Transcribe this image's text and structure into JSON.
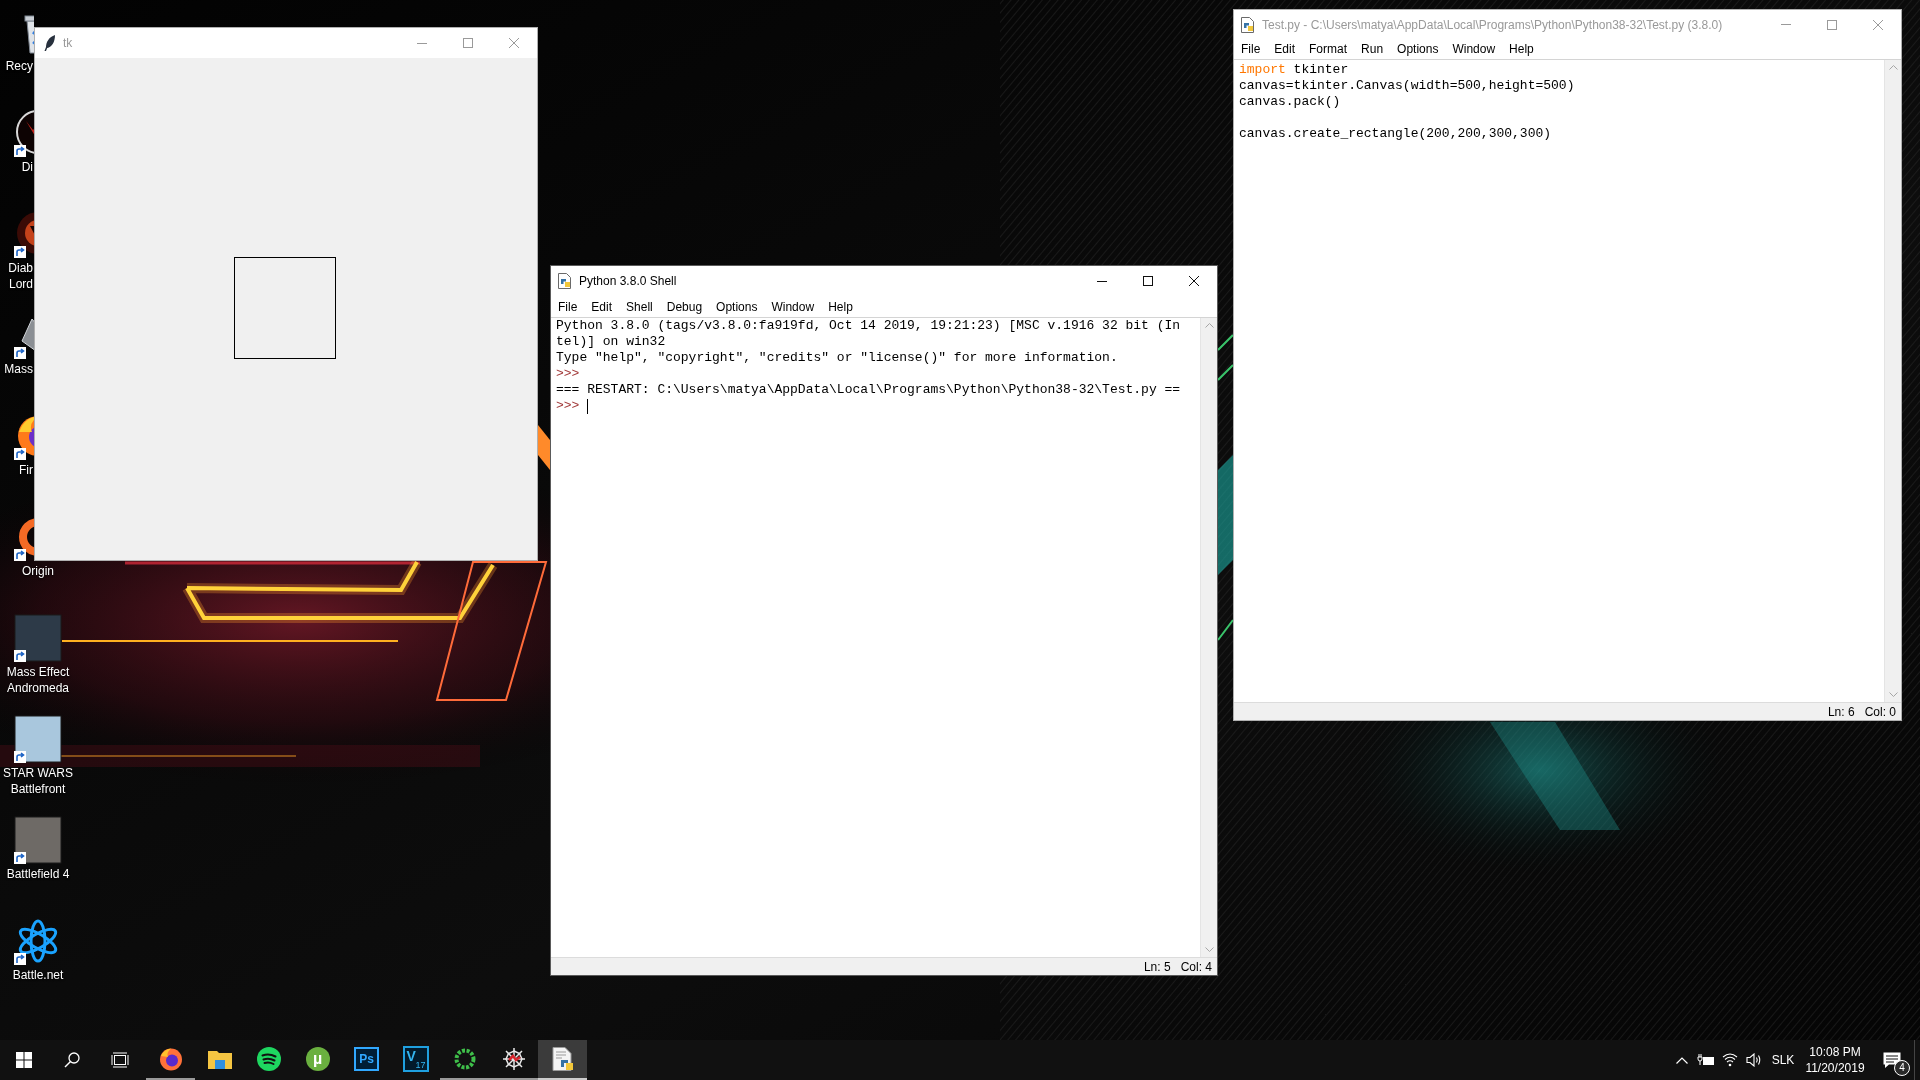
{
  "desktop_icons": [
    {
      "label": "Recy",
      "kind": "bin",
      "shortcut": false
    },
    {
      "label": "Di",
      "kind": "demon",
      "shortcut": true
    },
    {
      "label": "Diab Lord",
      "kind": "fiend",
      "shortcut": true
    },
    {
      "label": "Mass",
      "kind": "shard",
      "shortcut": true
    },
    {
      "label": "Fir",
      "kind": "browser",
      "shortcut": true
    },
    {
      "label": "Origin",
      "kind": "ring",
      "shortcut": true
    },
    {
      "label": "Mass Effect Andromeda",
      "kind": "cover",
      "color": "#2d3a48",
      "shortcut": true
    },
    {
      "label": "STAR WARS Battlefront",
      "kind": "cover",
      "color": "#a9c7dd",
      "shortcut": true
    },
    {
      "label": "Battlefield 4",
      "kind": "cover",
      "color": "#6e6a66",
      "shortcut": true
    },
    {
      "label": "Battle.net",
      "kind": "swirl",
      "shortcut": true
    }
  ],
  "tk_window": {
    "title": "tk",
    "active": false
  },
  "shell_window": {
    "title": "Python 3.8.0 Shell",
    "active": true,
    "menu": [
      "File",
      "Edit",
      "Shell",
      "Debug",
      "Options",
      "Window",
      "Help"
    ],
    "lines": [
      {
        "kind": "output",
        "text": "Python 3.8.0 (tags/v3.8.0:fa919fd, Oct 14 2019, 19:21:23) [MSC v.1916 32 bit (In",
        "cursor": false
      },
      {
        "kind": "output",
        "text": "tel)] on win32",
        "cursor": false
      },
      {
        "kind": "output",
        "text": "Type \"help\", \"copyright\", \"credits\" or \"license()\" for more information.",
        "cursor": false
      },
      {
        "kind": "prompt",
        "text": ">>>",
        "cursor": false
      },
      {
        "kind": "output",
        "text": "=== RESTART: C:\\Users\\matya\\AppData\\Local\\Programs\\Python\\Python38-32\\Test.py ==",
        "cursor": false
      },
      {
        "kind": "prompt",
        "text": ">>>",
        "cursor": true
      }
    ],
    "status": [
      "Ln: 5",
      "Col: 4"
    ]
  },
  "editor_window": {
    "title": "Test.py - C:\\Users\\matya\\AppData\\Local\\Programs\\Python\\Python38-32\\Test.py (3.8.0)",
    "active": false,
    "menu": [
      "File",
      "Edit",
      "Format",
      "Run",
      "Options",
      "Window",
      "Help"
    ],
    "code": [
      {
        "kind": "code",
        "tokens": [
          {
            "kind": "keyword",
            "text": "import"
          },
          {
            "kind": "plain",
            "text": " tkinter"
          }
        ]
      },
      {
        "kind": "code",
        "tokens": [
          {
            "kind": "plain",
            "text": "canvas=tkinter.Canvas(width=500,height=500)"
          }
        ]
      },
      {
        "kind": "code",
        "tokens": [
          {
            "kind": "plain",
            "text": "canvas.pack()"
          }
        ]
      },
      {
        "kind": "blank"
      },
      {
        "kind": "code",
        "tokens": [
          {
            "kind": "plain",
            "text": "canvas.create_rectangle(200,200,300,300)"
          }
        ]
      }
    ],
    "status": [
      "Ln: 6",
      "Col: 0"
    ]
  },
  "taskbar": {
    "apps": [
      {
        "kind": "browser",
        "running": true,
        "selected": false
      },
      {
        "kind": "folder",
        "running": false,
        "selected": false
      },
      {
        "kind": "music",
        "running": false,
        "selected": false
      },
      {
        "kind": "torrent",
        "logo": "µ",
        "running": false,
        "selected": false
      },
      {
        "kind": "photo",
        "logo": "Ps",
        "running": false,
        "selected": false
      },
      {
        "kind": "video",
        "logo": "V",
        "logo_mark": "17",
        "running": false,
        "selected": false
      },
      {
        "kind": "ring",
        "running": true,
        "selected": false
      },
      {
        "kind": "web",
        "running": true,
        "selected": false
      },
      {
        "kind": "editor",
        "running": true,
        "selected": true
      }
    ],
    "tray": {
      "language": "SLK",
      "time": "10:08 PM",
      "date": "11/20/2019",
      "notifications": "4"
    }
  }
}
